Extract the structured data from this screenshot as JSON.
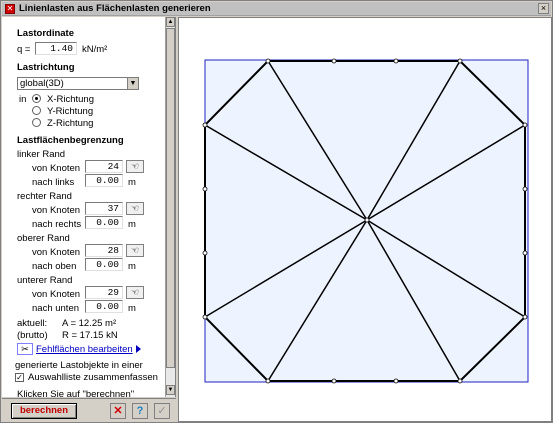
{
  "window": {
    "title": "Linienlasten aus Flächenlasten generieren"
  },
  "load": {
    "heading": "Lastordinate",
    "q_label": "q =",
    "q_value": "1.40",
    "q_unit": "kN/m²"
  },
  "direction": {
    "heading": "Lastrichtung",
    "selected": "global(3D)",
    "in_label": "in",
    "options": [
      "X-Richtung",
      "Y-Richtung",
      "Z-Richtung"
    ],
    "checked_index": 0
  },
  "boundary": {
    "heading": "Lastflächenbegrenzung",
    "node_label": "von Knoten",
    "unit": "m",
    "left": {
      "title": "linker Rand",
      "node": "24",
      "offset_label": "nach links",
      "offset": "0.00"
    },
    "right": {
      "title": "rechter Rand",
      "node": "37",
      "offset_label": "nach rechts",
      "offset": "0.00"
    },
    "top": {
      "title": "oberer Rand",
      "node": "28",
      "offset_label": "nach oben",
      "offset": "0.00"
    },
    "bottom": {
      "title": "unterer Rand",
      "node": "29",
      "offset_label": "nach unten",
      "offset": "0.00"
    }
  },
  "summary": {
    "current_label": "aktuell:",
    "area": "A = 12.25 m²",
    "gross_label": "(brutto)",
    "resultant": "R = 17.15 kN"
  },
  "edit_link": "Fehlflächen bearbeiten",
  "generated_text": "generierte Lastobjekte in einer",
  "selection_checkbox": "Auswahlliste zusammenfassen",
  "hint_text": "Klicken Sie auf \"berechnen\"",
  "buttons": {
    "calculate": "berechnen"
  },
  "icons": {
    "pick": "node-pick-icon",
    "scissors": "scissors-icon",
    "cancel": "cancel-icon",
    "help": "help-icon",
    "ok": "checkmark-icon"
  },
  "colors": {
    "fill": "#eef4ff",
    "outline": "#2020c0",
    "title_red": "#c00000"
  }
}
